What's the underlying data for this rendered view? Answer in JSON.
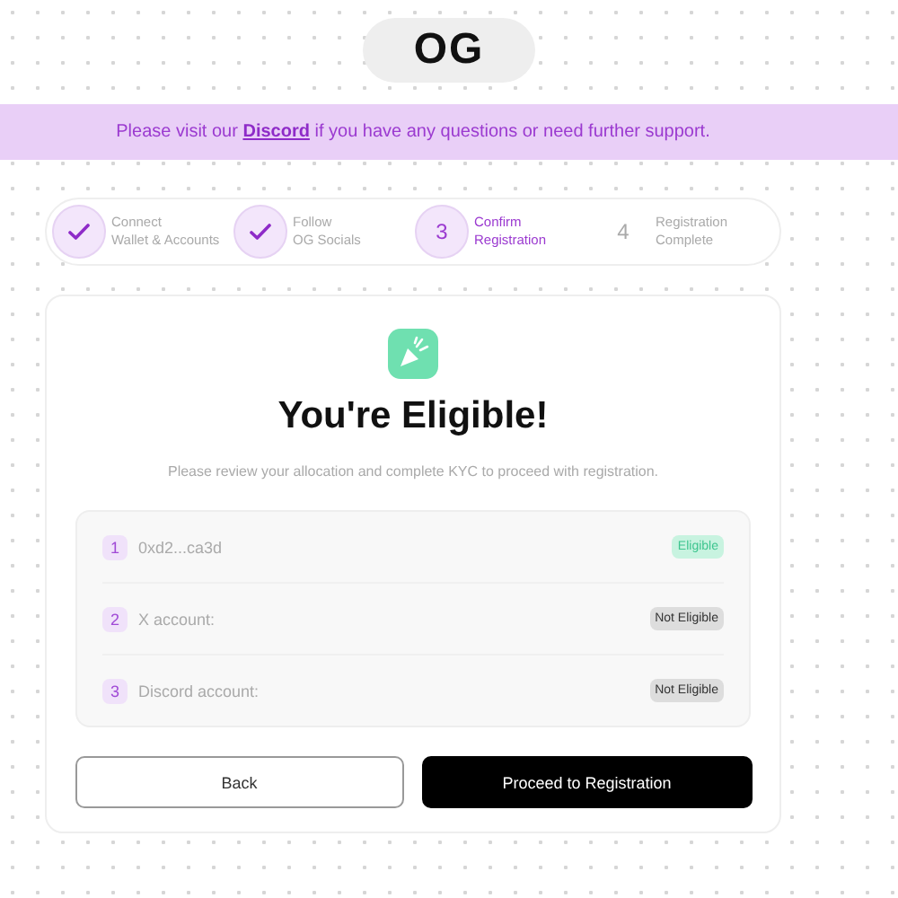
{
  "logo": {
    "text": "OG"
  },
  "banner": {
    "before": "Please visit our",
    "link": "Discord",
    "after": "if you have any questions or need further support."
  },
  "steps": [
    {
      "kind": "done",
      "line1": "Connect",
      "line2": "Wallet & Accounts"
    },
    {
      "kind": "done",
      "line1": "Follow",
      "line2": "OG Socials"
    },
    {
      "kind": "active",
      "number": "3",
      "line1": "Confirm",
      "line2": "Registration"
    },
    {
      "kind": "pending",
      "number": "4",
      "line1": "Registration",
      "line2": "Complete"
    }
  ],
  "title": "You're Eligible!",
  "subtitle": "Please review your allocation and complete KYC to proceed with registration.",
  "checks": [
    {
      "number": "1",
      "label": "0xd2...ca3d",
      "status": "Eligible",
      "eligible": true
    },
    {
      "number": "2",
      "label": "X account:",
      "status": "Not Eligible",
      "eligible": false
    },
    {
      "number": "3",
      "label": "Discord account:",
      "status": "Not Eligible",
      "eligible": false
    }
  ],
  "buttons": [
    {
      "label": "Back",
      "kind": "secondary"
    },
    {
      "label": "Proceed to Registration",
      "kind": "primary"
    }
  ]
}
